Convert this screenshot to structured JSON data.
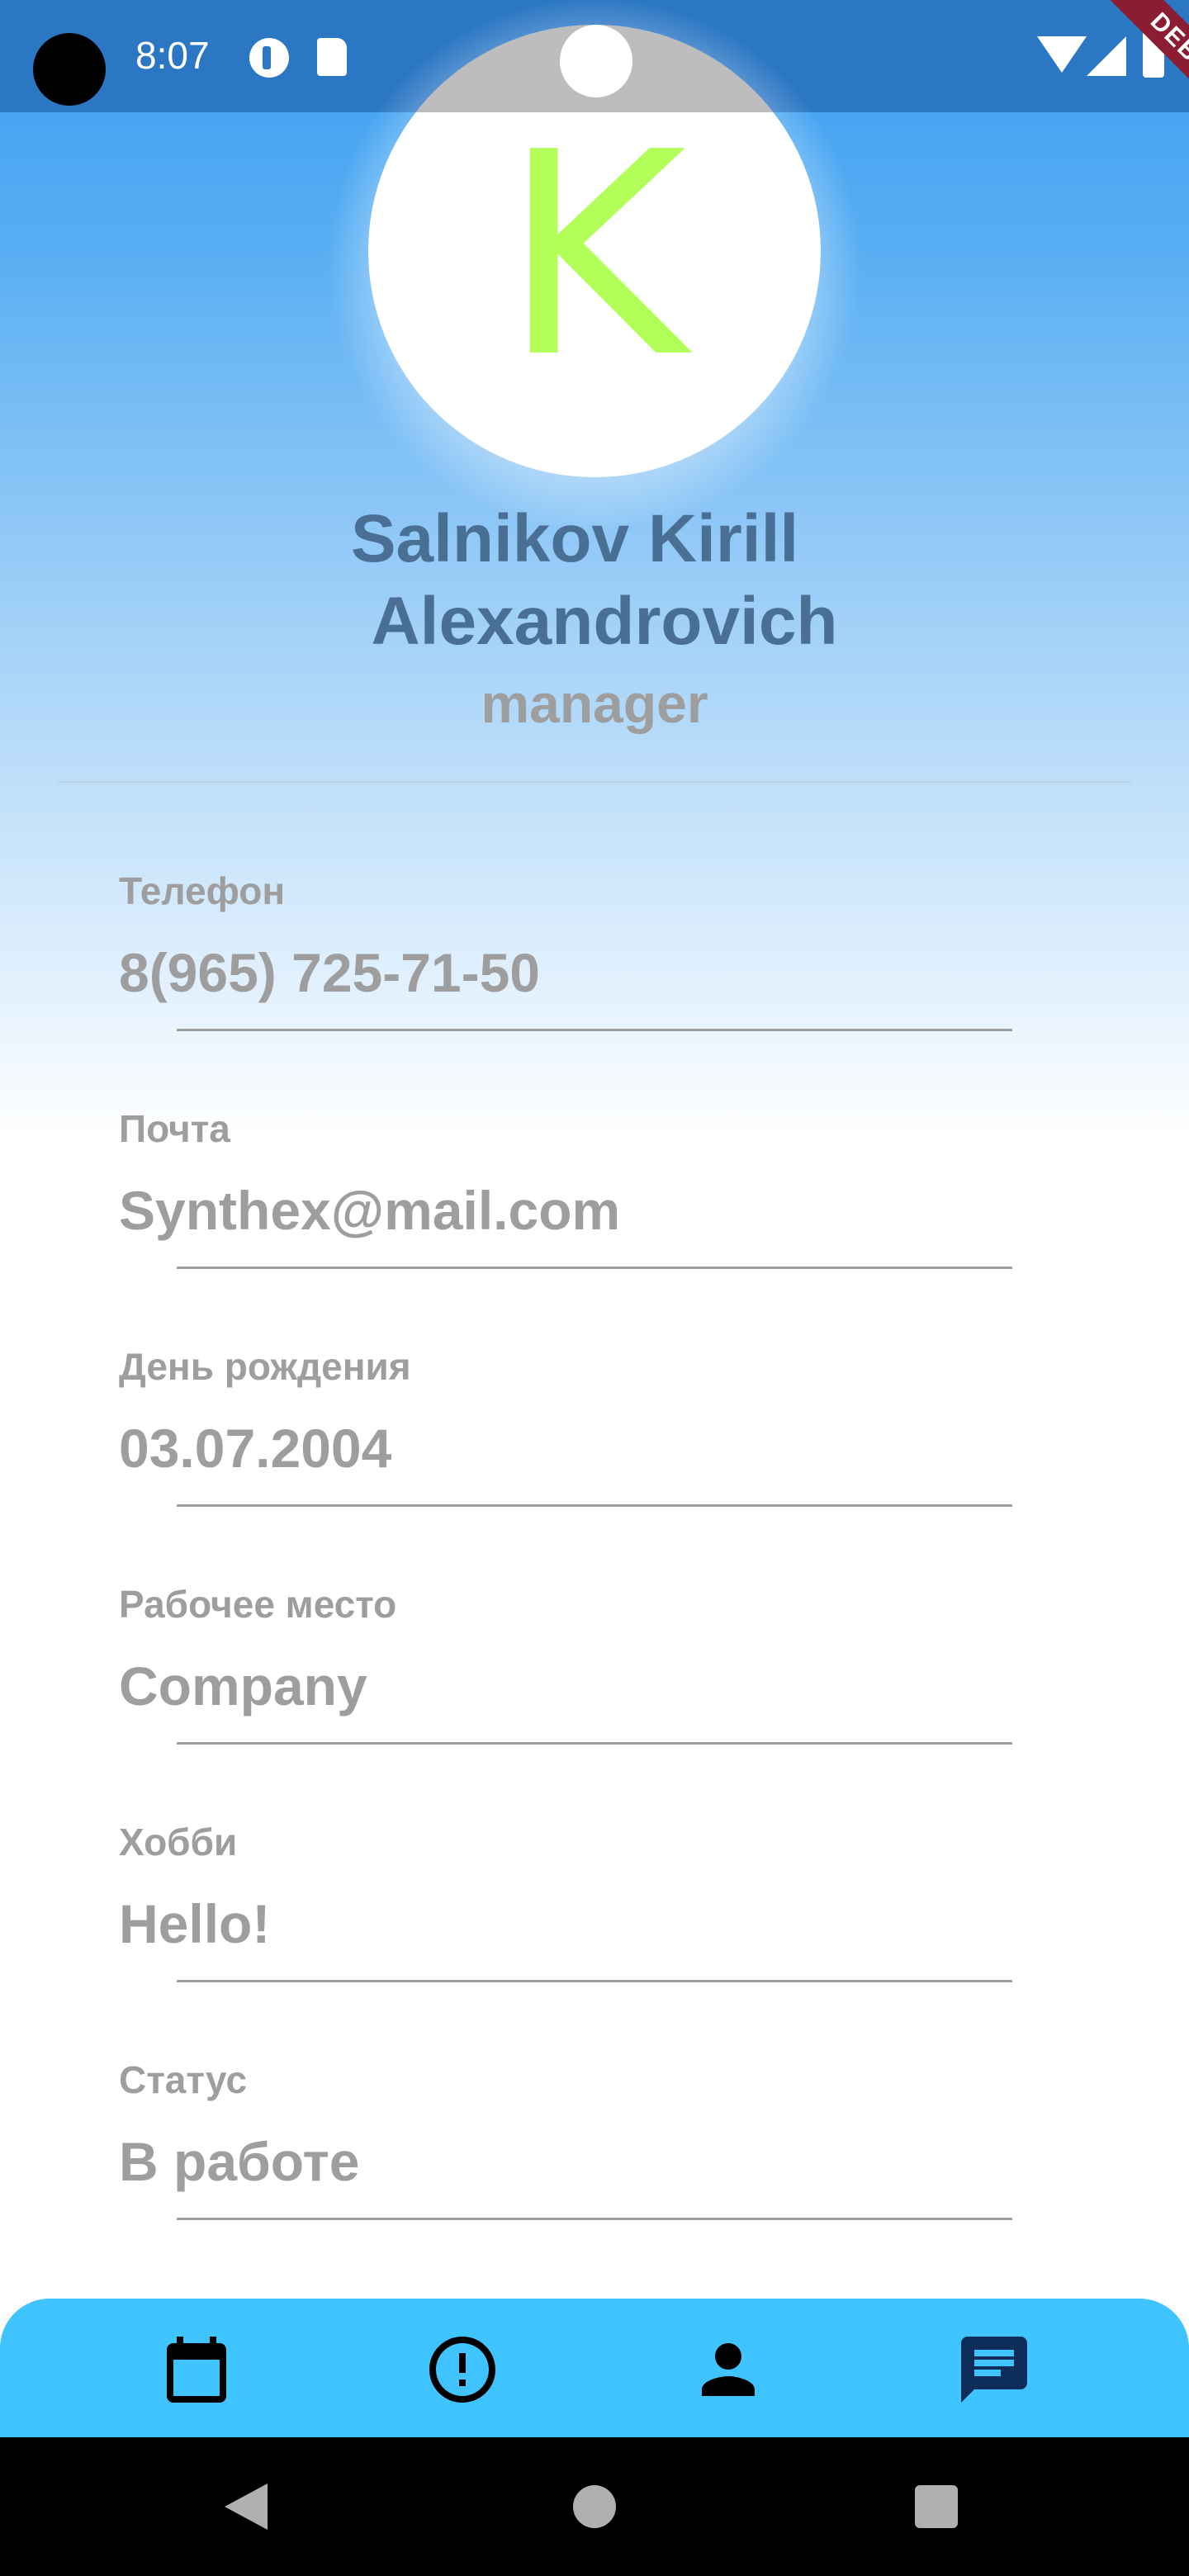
{
  "status_bar": {
    "time": "8:07",
    "debug_banner": "DEBUG"
  },
  "profile": {
    "avatar_letter": "K",
    "name_line1": "Salnikov Kirill",
    "name_line2": "Alexandrovich",
    "role": "manager"
  },
  "fields": [
    {
      "label": "Телефон",
      "value": "8(965) 725-71-50"
    },
    {
      "label": "Почта",
      "value": "Synthex@mail.com"
    },
    {
      "label": "День рождения",
      "value": "03.07.2004"
    },
    {
      "label": "Рабочее место",
      "value": "Company"
    },
    {
      "label": "Хобби",
      "value": "Hello!"
    },
    {
      "label": "Статус",
      "value": "В работе"
    }
  ],
  "bottom_nav": {
    "items": [
      {
        "icon": "calendar-icon"
      },
      {
        "icon": "alert-circle-icon"
      },
      {
        "icon": "person-icon"
      },
      {
        "icon": "chat-icon",
        "active": true
      }
    ]
  },
  "colors": {
    "accent": "#40c4ff",
    "avatar_letter": "#b2ff59",
    "name": "#4a6f95",
    "muted_text": "#9e9e9e"
  }
}
